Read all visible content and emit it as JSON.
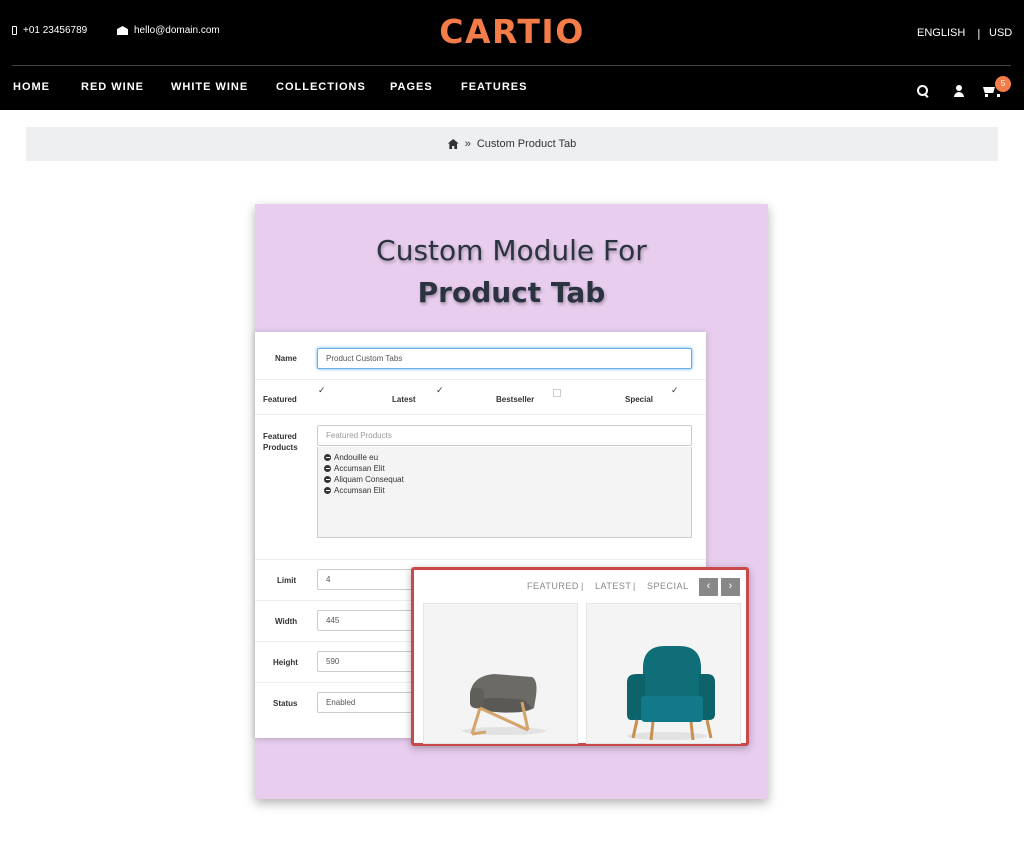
{
  "header": {
    "phone": "+01 23456789",
    "email": "hello@domain.com",
    "logo": "CARTIO",
    "language": "ENGLISH",
    "currency": "USD",
    "cart_count": "5"
  },
  "nav": {
    "items": [
      "HOME",
      "RED WINE",
      "WHITE WINE",
      "COLLECTIONS",
      "PAGES",
      "FEATURES"
    ]
  },
  "breadcrumb": {
    "separator": "»",
    "current": "Custom Product Tab"
  },
  "banner": {
    "title_line1": "Custom Module For",
    "title_line2": "Product Tab",
    "form": {
      "name_label": "Name",
      "name_value": "Product Custom Tabs",
      "checkboxes": [
        {
          "label": "Featured",
          "checked": true
        },
        {
          "label": "Latest",
          "checked": true
        },
        {
          "label": "Bestseller",
          "checked": false
        },
        {
          "label": "Special",
          "checked": true
        }
      ],
      "featured_label_1": "Featured",
      "featured_label_2": "Products",
      "featured_placeholder": "Featured Products",
      "featured_items": [
        "Andouille eu",
        "Accumsan Elit",
        "Aliquam Consequat",
        "Accumsan Elit"
      ],
      "limit_label": "Limit",
      "limit_value": "4",
      "width_label": "Width",
      "width_value": "445",
      "height_label": "Height",
      "height_value": "590",
      "status_label": "Status",
      "status_value": "Enabled"
    },
    "preview": {
      "tabs": [
        "FEATURED",
        "LATEST",
        "SPECIAL"
      ],
      "separator": "|",
      "prev": "‹",
      "next": "›"
    }
  },
  "colors": {
    "accent": "#f47c48",
    "banner_bg": "#e8cdee",
    "preview_border": "#c9484a",
    "teal_chair": "#0f6e78"
  }
}
